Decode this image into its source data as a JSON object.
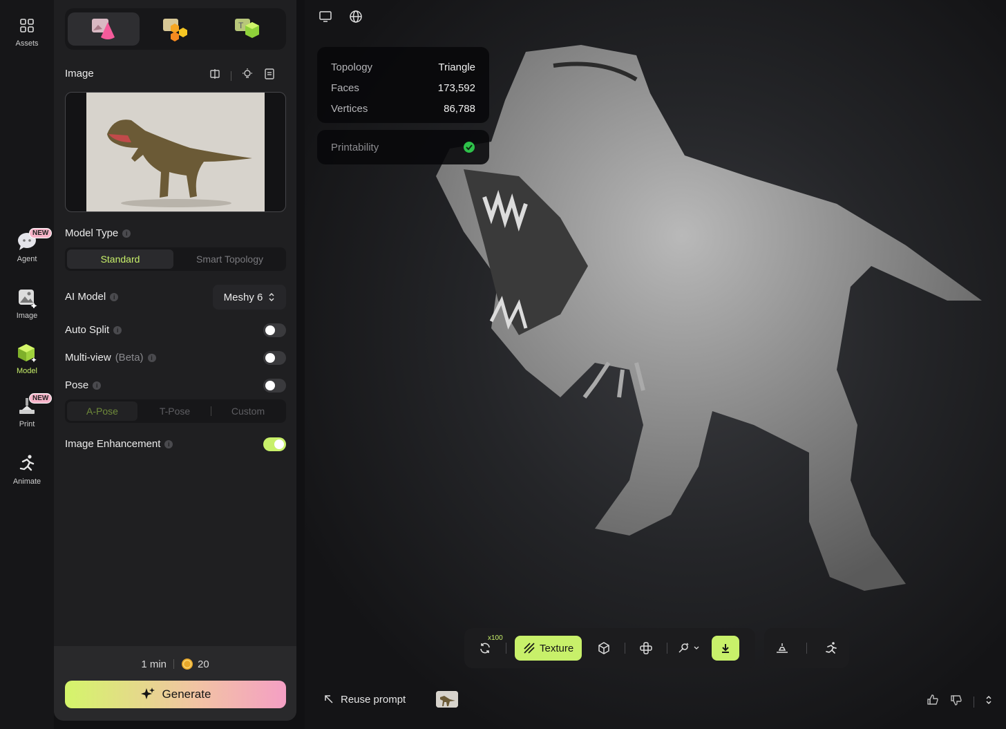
{
  "rail": {
    "assets": "Assets",
    "agent": "Agent",
    "image": "Image",
    "model": "Model",
    "print": "Print",
    "animate": "Animate",
    "new_badge": "NEW"
  },
  "panel": {
    "image_section": "Image",
    "model_type_label": "Model Type",
    "model_type_options": [
      "Standard",
      "Smart Topology"
    ],
    "ai_model_label": "AI Model",
    "ai_model_value": "Meshy 6",
    "auto_split_label": "Auto Split",
    "multiview_label": "Multi-view",
    "multiview_beta": "(Beta)",
    "pose_label": "Pose",
    "pose_options": [
      "A-Pose",
      "T-Pose",
      "Custom"
    ],
    "image_enhancement_label": "Image Enhancement",
    "toggles": {
      "auto_split": false,
      "multiview": false,
      "pose": false,
      "image_enhancement": true
    },
    "time": "1 min",
    "credits": "20",
    "generate": "Generate"
  },
  "viewport": {
    "stats": [
      {
        "key": "Topology",
        "value": "Triangle"
      },
      {
        "key": "Faces",
        "value": "173,592"
      },
      {
        "key": "Vertices",
        "value": "86,788"
      }
    ],
    "printability": "Printability",
    "toolbar": {
      "x100": "x100",
      "texture": "Texture"
    },
    "reuse_prompt": "Reuse prompt"
  },
  "colors": {
    "accent": "#c8f06a",
    "panel": "#1f1f21",
    "bg": "#111113"
  }
}
